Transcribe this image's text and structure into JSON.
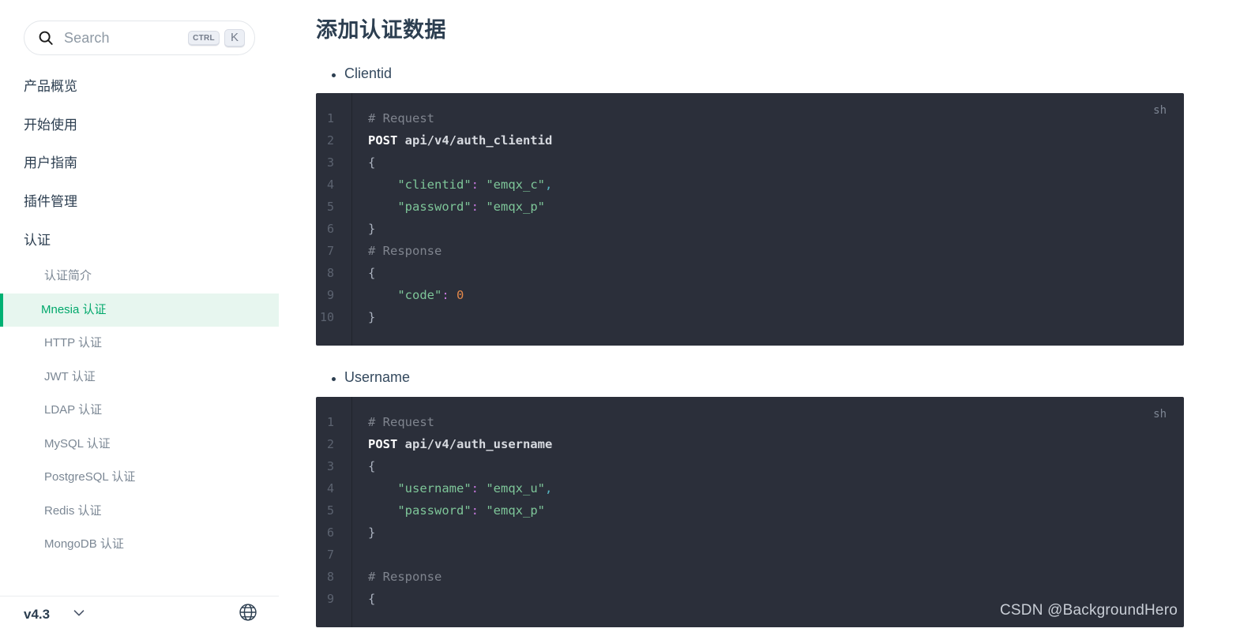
{
  "search": {
    "placeholder": "Search",
    "icon": "search-icon",
    "shortcut": {
      "modifier": "CTRL",
      "key": "K"
    }
  },
  "sidebar": {
    "top_items": [
      {
        "label": "产品概览"
      },
      {
        "label": "开始使用"
      },
      {
        "label": "用户指南"
      },
      {
        "label": "插件管理"
      },
      {
        "label": "认证"
      }
    ],
    "sub_items": [
      {
        "label": "认证简介",
        "active": false
      },
      {
        "label": "Mnesia 认证",
        "active": true
      },
      {
        "label": "HTTP 认证",
        "active": false
      },
      {
        "label": "JWT 认证",
        "active": false
      },
      {
        "label": "LDAP 认证",
        "active": false
      },
      {
        "label": "MySQL 认证",
        "active": false
      },
      {
        "label": "PostgreSQL 认证",
        "active": false
      },
      {
        "label": "Redis 认证",
        "active": false
      },
      {
        "label": "MongoDB 认证",
        "active": false
      }
    ],
    "footer": {
      "version": "v4.3",
      "chevron_icon": "chevron-down-icon",
      "language_icon": "globe-icon"
    },
    "accent_color": "#00b173",
    "active_background": "#e7f6ef"
  },
  "main": {
    "title": "添加认证数据",
    "sections": [
      {
        "bullet": "Clientid",
        "code": {
          "lang": "sh",
          "lines": [
            {
              "n": "1",
              "tokens": [
                {
                  "t": "comment",
                  "v": "# Request"
                }
              ]
            },
            {
              "n": "2",
              "tokens": [
                {
                  "t": "kw",
                  "v": "POST"
                },
                {
                  "t": "plain",
                  "v": " "
                },
                {
                  "t": "path",
                  "v": "api/v4/auth_clientid"
                }
              ]
            },
            {
              "n": "3",
              "tokens": [
                {
                  "t": "punc",
                  "v": "{"
                }
              ]
            },
            {
              "n": "4",
              "tokens": [
                {
                  "t": "plain",
                  "v": "    "
                },
                {
                  "t": "key",
                  "v": "\"clientid\""
                },
                {
                  "t": "colon",
                  "v": ":"
                },
                {
                  "t": "plain",
                  "v": " "
                },
                {
                  "t": "str",
                  "v": "\"emqx_c\""
                },
                {
                  "t": "comma",
                  "v": ","
                }
              ]
            },
            {
              "n": "5",
              "tokens": [
                {
                  "t": "plain",
                  "v": "    "
                },
                {
                  "t": "key",
                  "v": "\"password\""
                },
                {
                  "t": "colon",
                  "v": ":"
                },
                {
                  "t": "plain",
                  "v": " "
                },
                {
                  "t": "str",
                  "v": "\"emqx_p\""
                }
              ]
            },
            {
              "n": "6",
              "tokens": [
                {
                  "t": "punc",
                  "v": "}"
                }
              ]
            },
            {
              "n": "7",
              "tokens": [
                {
                  "t": "comment",
                  "v": "# Response"
                }
              ]
            },
            {
              "n": "8",
              "tokens": [
                {
                  "t": "punc",
                  "v": "{"
                }
              ]
            },
            {
              "n": "9",
              "tokens": [
                {
                  "t": "plain",
                  "v": "    "
                },
                {
                  "t": "key",
                  "v": "\"code\""
                },
                {
                  "t": "colon",
                  "v": ":"
                },
                {
                  "t": "plain",
                  "v": " "
                },
                {
                  "t": "num",
                  "v": "0"
                }
              ]
            },
            {
              "n": "10",
              "tokens": [
                {
                  "t": "punc",
                  "v": "}"
                }
              ]
            }
          ]
        }
      },
      {
        "bullet": "Username",
        "code": {
          "lang": "sh",
          "lines": [
            {
              "n": "1",
              "tokens": [
                {
                  "t": "comment",
                  "v": "# Request"
                }
              ]
            },
            {
              "n": "2",
              "tokens": [
                {
                  "t": "kw",
                  "v": "POST"
                },
                {
                  "t": "plain",
                  "v": " "
                },
                {
                  "t": "path",
                  "v": "api/v4/auth_username"
                }
              ]
            },
            {
              "n": "3",
              "tokens": [
                {
                  "t": "punc",
                  "v": "{"
                }
              ]
            },
            {
              "n": "4",
              "tokens": [
                {
                  "t": "plain",
                  "v": "    "
                },
                {
                  "t": "key",
                  "v": "\"username\""
                },
                {
                  "t": "colon",
                  "v": ":"
                },
                {
                  "t": "plain",
                  "v": " "
                },
                {
                  "t": "str",
                  "v": "\"emqx_u\""
                },
                {
                  "t": "comma",
                  "v": ","
                }
              ]
            },
            {
              "n": "5",
              "tokens": [
                {
                  "t": "plain",
                  "v": "    "
                },
                {
                  "t": "key",
                  "v": "\"password\""
                },
                {
                  "t": "colon",
                  "v": ":"
                },
                {
                  "t": "plain",
                  "v": " "
                },
                {
                  "t": "str",
                  "v": "\"emqx_p\""
                }
              ]
            },
            {
              "n": "6",
              "tokens": [
                {
                  "t": "punc",
                  "v": "}"
                }
              ]
            },
            {
              "n": "7",
              "tokens": []
            },
            {
              "n": "8",
              "tokens": [
                {
                  "t": "comment",
                  "v": "# Response"
                }
              ]
            },
            {
              "n": "9",
              "tokens": [
                {
                  "t": "punc",
                  "v": "{"
                }
              ]
            }
          ]
        }
      }
    ]
  },
  "watermark": "CSDN @BackgroundHero"
}
